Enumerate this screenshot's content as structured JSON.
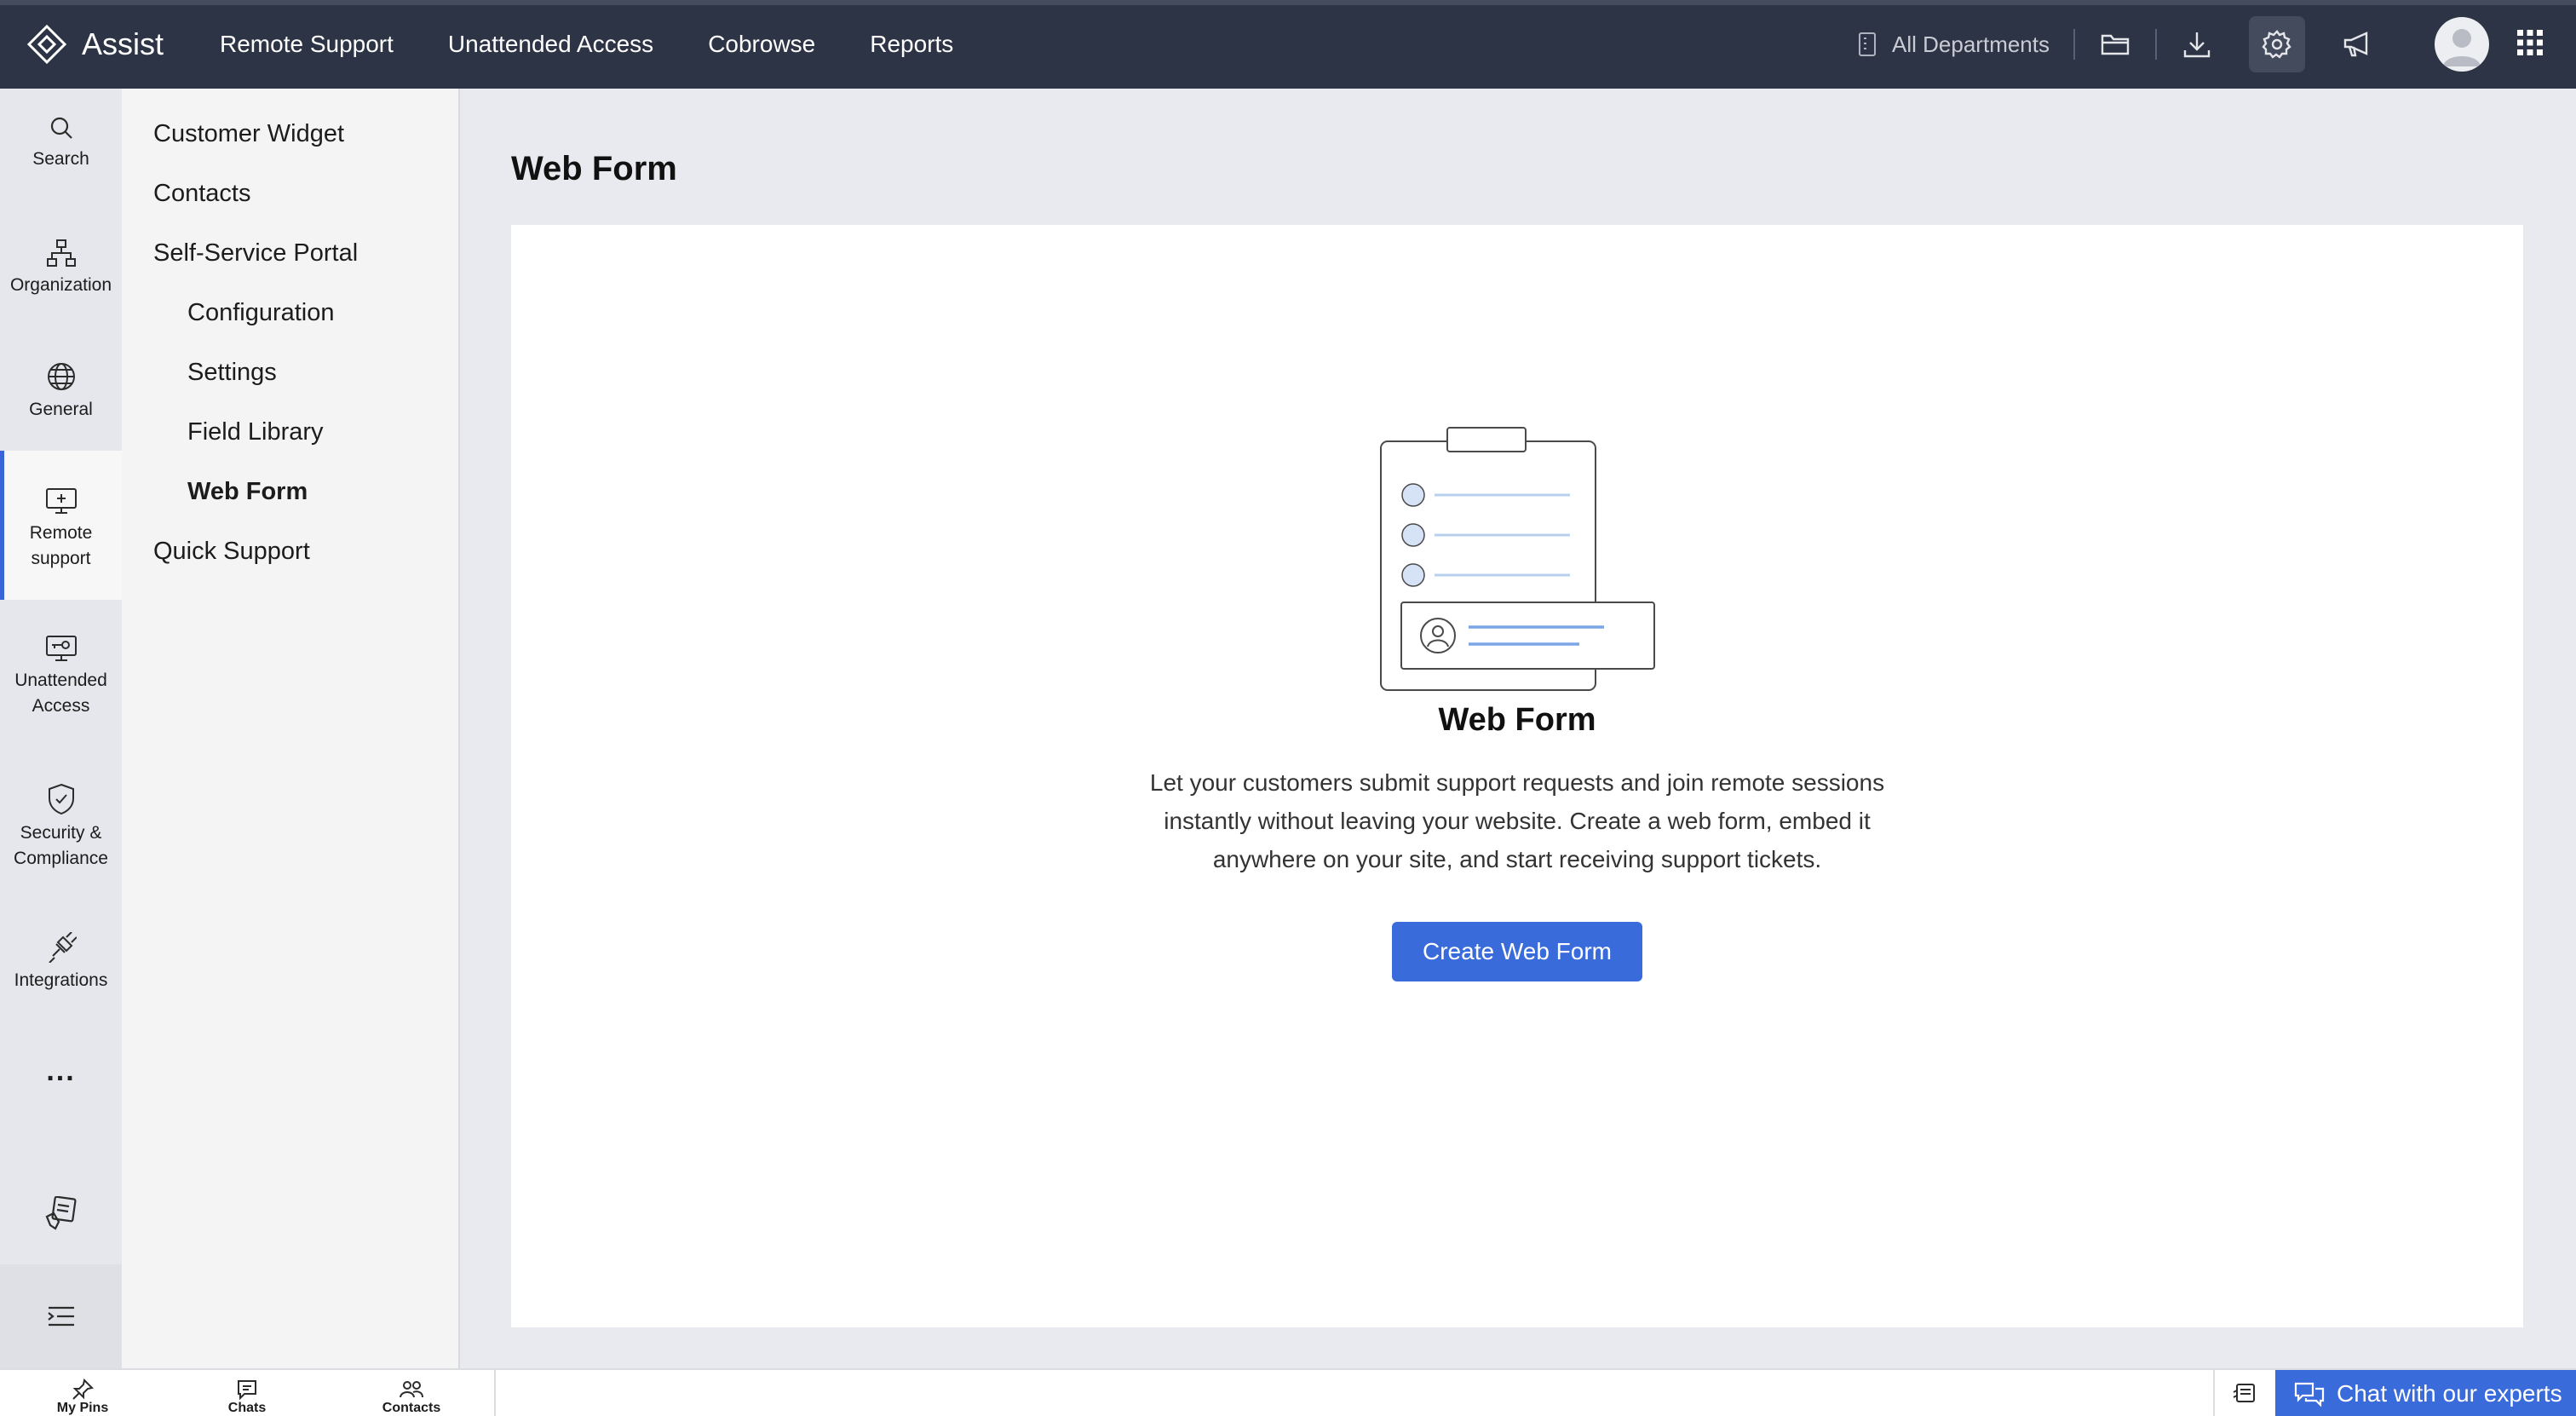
{
  "app": {
    "name": "Assist"
  },
  "topnav": {
    "items": [
      "Remote Support",
      "Unattended Access",
      "Cobrowse",
      "Reports"
    ],
    "department": "All Departments"
  },
  "rail": {
    "items": [
      {
        "label": "Search",
        "icon": "search-icon"
      },
      {
        "label": "Organization",
        "icon": "organization-icon"
      },
      {
        "label": "General",
        "icon": "globe-icon"
      },
      {
        "label": "Remote support",
        "icon": "monitor-plus-icon",
        "active": true
      },
      {
        "label": "Unattended Access",
        "icon": "monitor-key-icon"
      },
      {
        "label": "Security & Compliance",
        "icon": "shield-check-icon"
      },
      {
        "label": "Integrations",
        "icon": "plug-icon"
      }
    ],
    "more": "...",
    "accent": "#3b64d8"
  },
  "submenu": {
    "items": [
      {
        "label": "Customer Widget",
        "level": 1
      },
      {
        "label": "Contacts",
        "level": 1
      },
      {
        "label": "Self-Service Portal",
        "level": 1
      },
      {
        "label": "Configuration",
        "level": 2
      },
      {
        "label": "Settings",
        "level": 2
      },
      {
        "label": "Field Library",
        "level": 2
      },
      {
        "label": "Web Form",
        "level": 2,
        "active": true
      },
      {
        "label": "Quick Support",
        "level": 1
      }
    ]
  },
  "main": {
    "title": "Web Form",
    "empty": {
      "title": "Web Form",
      "description": "Let your customers submit support requests and join remote sessions instantly without leaving your website. Create a web form, embed it anywhere on your site, and start receiving support tickets.",
      "button": "Create Web Form"
    }
  },
  "bottombar": {
    "items": [
      "My Pins",
      "Chats",
      "Contacts"
    ],
    "chat_label": "Chat with our experts"
  },
  "colors": {
    "topbar": "#2d3445",
    "primary": "#3a6bdb"
  }
}
